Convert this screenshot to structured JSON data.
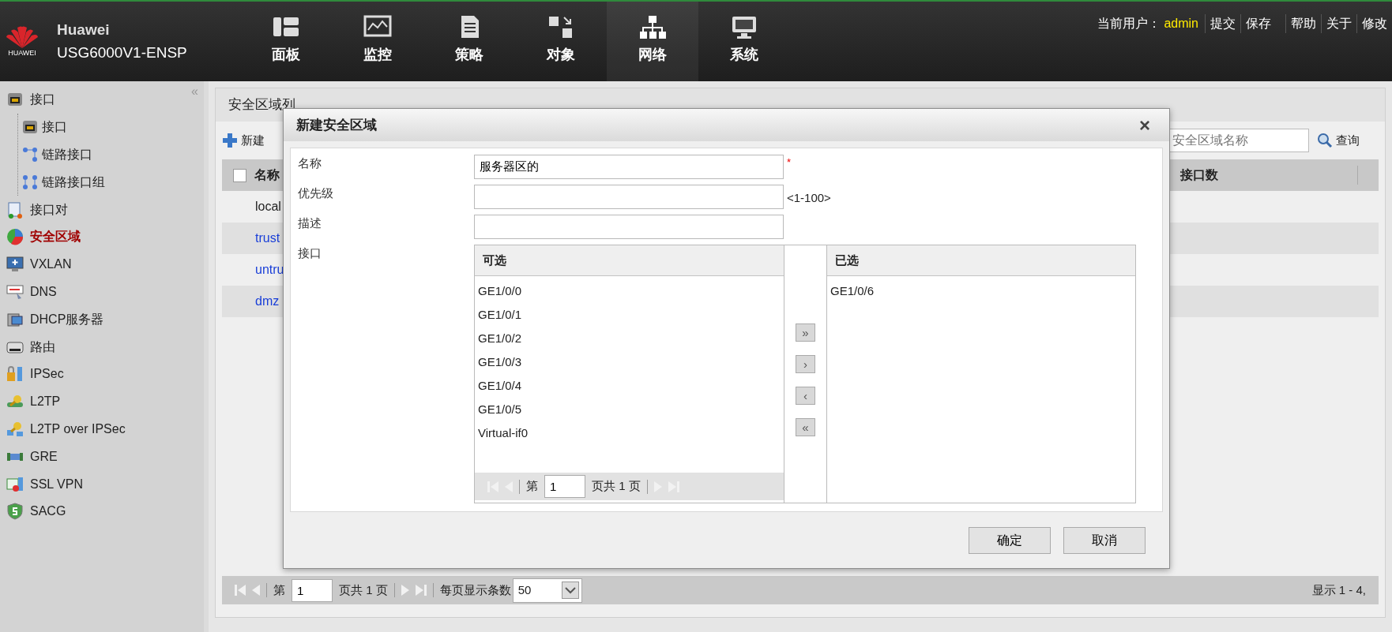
{
  "header": {
    "logo_text": "HUAWEI",
    "brand": "Huawei",
    "model": "USG6000V1-ENSP",
    "nav": [
      {
        "label": "面板",
        "selected": false
      },
      {
        "label": "监控",
        "selected": false
      },
      {
        "label": "策略",
        "selected": false
      },
      {
        "label": "对象",
        "selected": false
      },
      {
        "label": "网络",
        "selected": true
      },
      {
        "label": "系统",
        "selected": false
      }
    ],
    "user_label": "当前用户：",
    "user": "admin",
    "actions": [
      "提交",
      "保存",
      "帮助",
      "关于",
      "修改"
    ]
  },
  "sidebar": {
    "collapse": "«",
    "items": [
      {
        "label": "接口",
        "selected": false,
        "children": [
          {
            "label": "接口",
            "selected": false
          },
          {
            "label": "链路接口",
            "selected": false
          },
          {
            "label": "链路接口组",
            "selected": false
          }
        ]
      },
      {
        "label": "接口对",
        "selected": false
      },
      {
        "label": "安全区域",
        "selected": true
      },
      {
        "label": "VXLAN",
        "selected": false
      },
      {
        "label": "DNS",
        "selected": false
      },
      {
        "label": "DHCP服务器",
        "selected": false
      },
      {
        "label": "路由",
        "selected": false
      },
      {
        "label": "IPSec",
        "selected": false
      },
      {
        "label": "L2TP",
        "selected": false
      },
      {
        "label": "L2TP over IPSec",
        "selected": false
      },
      {
        "label": "GRE",
        "selected": false
      },
      {
        "label": "SSL VPN",
        "selected": false
      },
      {
        "label": "SACG",
        "selected": false
      }
    ]
  },
  "main": {
    "title": "安全区域列",
    "new_button": "新建",
    "search": {
      "placeholder": "安全区域名称"
    },
    "search_button": "查询",
    "table": {
      "select_all_checked": false,
      "columns": [
        "名称",
        "接口数"
      ],
      "rows": [
        {
          "name": "local",
          "link": false
        },
        {
          "name": "trust",
          "link": true
        },
        {
          "name": "untru",
          "link": true
        },
        {
          "name": "dmz",
          "link": true
        }
      ]
    },
    "pager": {
      "page_label": "第",
      "page": "1",
      "total": "页共 1 页",
      "per_page_label": "每页显示条数",
      "per_page": "50",
      "summary": "显示 1 - 4,"
    }
  },
  "dialog": {
    "title": "新建安全区域",
    "close": "×",
    "fields": [
      {
        "label": "名称",
        "value": "服务器区的",
        "suffix": "*"
      },
      {
        "label": "优先级",
        "suffix": "<1-100>"
      },
      {
        "label": "描述"
      }
    ],
    "interface": {
      "label": "接口",
      "available_title": "可选",
      "chosen_title": "已选",
      "available": [
        "GE1/0/0",
        "GE1/0/1",
        "GE1/0/2",
        "GE1/0/3",
        "GE1/0/4",
        "GE1/0/5",
        "Virtual-if0"
      ],
      "chosen": [
        "GE1/0/6"
      ],
      "move_buttons": [
        "»",
        "›",
        "‹",
        "«"
      ],
      "pager": {
        "page_label": "第",
        "page": "1",
        "total": "页共 1 页"
      }
    },
    "buttons": [
      "确定",
      "取消"
    ]
  }
}
